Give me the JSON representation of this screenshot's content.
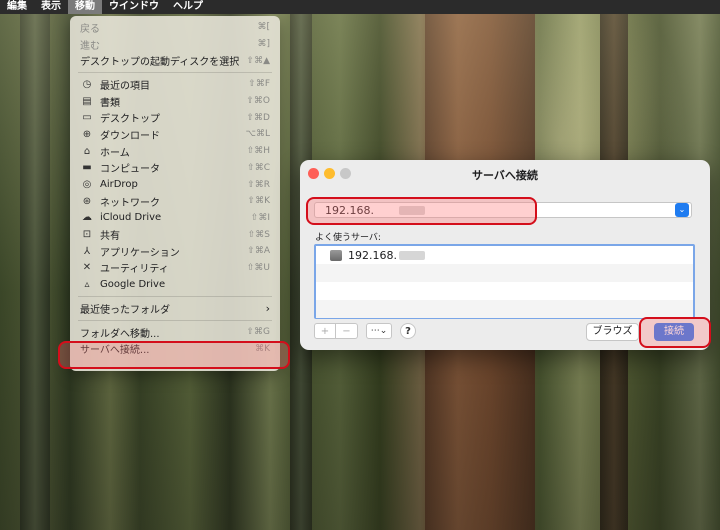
{
  "menubar": {
    "items": [
      "編集",
      "表示",
      "移動",
      "ウインドウ",
      "ヘルプ"
    ],
    "active_index": 2
  },
  "go_menu": {
    "back": {
      "label": "戻る",
      "shortcut": "⌘["
    },
    "forward": {
      "label": "進む",
      "shortcut": "⌘]"
    },
    "startup": {
      "label": "デスクトップの起動ディスクを選択",
      "shortcut": "⇧⌘▲"
    },
    "places": [
      {
        "icon": "clock-icon",
        "glyph": "◷",
        "label": "最近の項目",
        "shortcut": "⇧⌘F"
      },
      {
        "icon": "document-icon",
        "glyph": "▤",
        "label": "書類",
        "shortcut": "⇧⌘O"
      },
      {
        "icon": "desktop-icon",
        "glyph": "▭",
        "label": "デスクトップ",
        "shortcut": "⇧⌘D"
      },
      {
        "icon": "download-icon",
        "glyph": "⊕",
        "label": "ダウンロード",
        "shortcut": "⌥⌘L"
      },
      {
        "icon": "home-icon",
        "glyph": "⌂",
        "label": "ホーム",
        "shortcut": "⇧⌘H"
      },
      {
        "icon": "computer-icon",
        "glyph": "▬",
        "label": "コンピュータ",
        "shortcut": "⇧⌘C"
      },
      {
        "icon": "airdrop-icon",
        "glyph": "◎",
        "label": "AirDrop",
        "shortcut": "⇧⌘R"
      },
      {
        "icon": "network-icon",
        "glyph": "⊛",
        "label": "ネットワーク",
        "shortcut": "⇧⌘K"
      },
      {
        "icon": "cloud-icon",
        "glyph": "☁",
        "label": "iCloud Drive",
        "shortcut": "⇧⌘I"
      },
      {
        "icon": "shared-folder-icon",
        "glyph": "⊡",
        "label": "共有",
        "shortcut": "⇧⌘S"
      },
      {
        "icon": "applications-icon",
        "glyph": "⅄",
        "label": "アプリケーション",
        "shortcut": "⇧⌘A"
      },
      {
        "icon": "utilities-icon",
        "glyph": "✕",
        "label": "ユーティリティ",
        "shortcut": "⇧⌘U"
      },
      {
        "icon": "google-drive-icon",
        "glyph": "▵",
        "label": "Google Drive",
        "shortcut": ""
      }
    ],
    "recent_folders": {
      "label": "最近使ったフォルダ"
    },
    "goto_folder": {
      "label": "フォルダへ移動...",
      "shortcut": "⇧⌘G"
    },
    "connect_server": {
      "label": "サーバへ接続...",
      "shortcut": "⌘K"
    }
  },
  "dialog": {
    "title": "サーバへ接続",
    "address_value": "192.168.",
    "favorites_label": "よく使うサーバ:",
    "favorites": [
      "192.168."
    ],
    "plus_label": "+",
    "minus_label": "−",
    "more_label": "⋯⌄",
    "help_label": "?",
    "browse_label": "ブラウズ",
    "connect_label": "接続",
    "accent_color": "#2d78f0"
  },
  "highlight_color": "#d40e1b"
}
